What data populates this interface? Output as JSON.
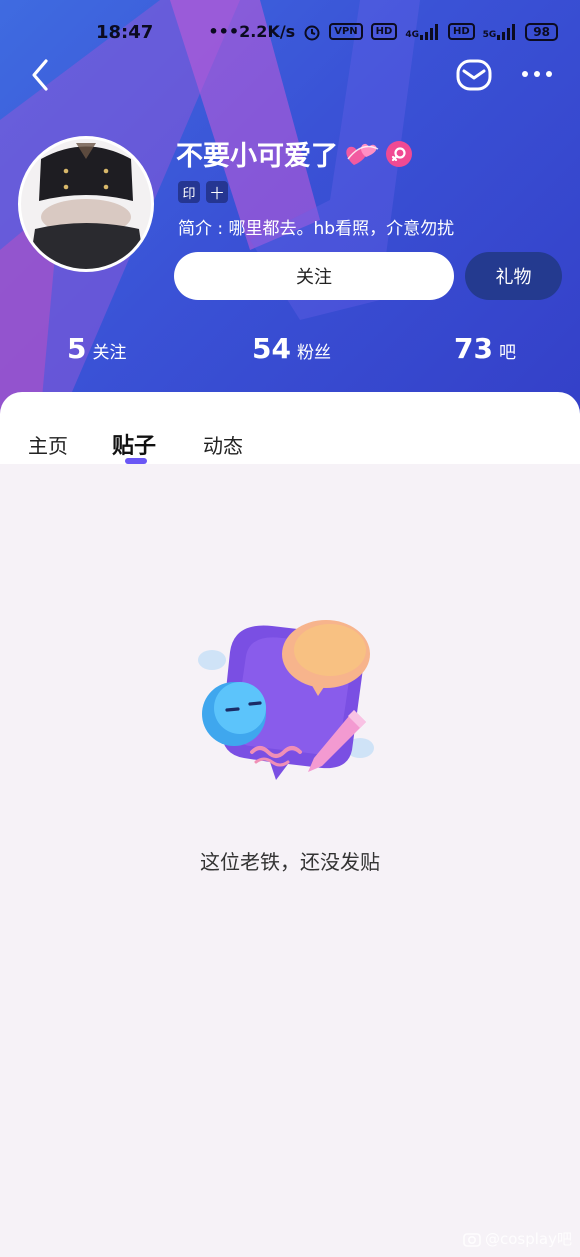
{
  "status_bar": {
    "time": "18:47",
    "network_speed": "2.2K/s",
    "vpn_label": "VPN",
    "hd1": "HD",
    "signal1_label": "4G",
    "hd2": "HD",
    "signal2_label": "5G",
    "battery": "98"
  },
  "nav": {
    "back_icon": "chevron-left",
    "mail_icon": "envelope",
    "more_icon": "ellipsis"
  },
  "profile": {
    "username": "不要小可爱了",
    "badges": [
      "印",
      "十"
    ],
    "bio": "简介 : 哪里都去。hb看照，介意勿扰",
    "follow_label": "关注",
    "gift_label": "礼物"
  },
  "stats": [
    {
      "value": "5",
      "label": "关注"
    },
    {
      "value": "54",
      "label": "粉丝"
    },
    {
      "value": "73",
      "label": "吧"
    }
  ],
  "tabs": [
    {
      "label": "主页"
    },
    {
      "label": "贴子"
    },
    {
      "label": "动态"
    }
  ],
  "active_tab": "贴子",
  "empty_state": {
    "message": "这位老铁，还没发贴"
  },
  "watermark": "@cosplay吧",
  "colors": {
    "header_gradient_start": "#3f6be0",
    "header_gradient_end": "#3440c8",
    "tab_indicator": "#6a57f5",
    "gift_button": "#243a8f",
    "page_bg": "#f6f2f7"
  }
}
